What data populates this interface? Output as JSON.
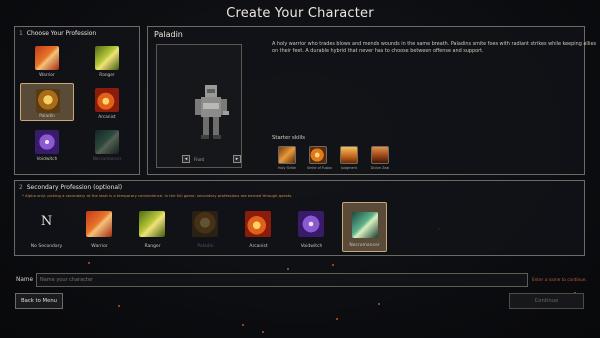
{
  "app": {
    "title": "Create Your Character"
  },
  "primary": {
    "number": "1",
    "heading": "Choose Your Profession",
    "professions": [
      {
        "label": "Warrior",
        "icon": "warrior-icon"
      },
      {
        "label": "Ranger",
        "icon": "ranger-icon"
      },
      {
        "label": "Paladin",
        "icon": "paladin-shield-icon",
        "selected": true
      },
      {
        "label": "Arcanist",
        "icon": "arcanist-fire-icon"
      },
      {
        "label": "Voidwitch",
        "icon": "voidwitch-lightning-icon"
      },
      {
        "label": "Necromancer",
        "icon": "necromancer-icon",
        "disabled": true
      }
    ]
  },
  "detail": {
    "name": "Paladin",
    "portrait_label": "Front",
    "prev_arrow": "◂",
    "next_arrow": "▸",
    "description": "A holy warrior who trades blows and mends wounds in the same breath. Paladins smite foes with radiant strikes while keeping allies on their feet. A durable hybrid that never has to choose between offense and support.",
    "starter_label": "Starter skills",
    "skills": [
      {
        "label": "Holy Strike",
        "icon": "holy-strike-icon"
      },
      {
        "label": "Smite of Fusion",
        "icon": "smite-icon"
      },
      {
        "label": "Judgment",
        "icon": "judgment-icon"
      },
      {
        "label": "Divine Zeal",
        "icon": "divine-zeal-icon"
      }
    ]
  },
  "secondary": {
    "number": "2",
    "heading": "Secondary Profession",
    "optional": "(optional)",
    "note": "* Alpha only: picking a secondary at the start is a temporary convenience. In the full game, secondary professions are earned through quests.",
    "options": [
      {
        "label": "No Secondary",
        "letter": "N"
      },
      {
        "label": "Warrior",
        "icon": "warrior-icon"
      },
      {
        "label": "Ranger",
        "icon": "ranger-icon"
      },
      {
        "label": "Paladin",
        "icon": "paladin-shield-icon",
        "disabled": true
      },
      {
        "label": "Arcanist",
        "icon": "arcanist-fire-icon"
      },
      {
        "label": "Voidwitch",
        "icon": "voidwitch-lightning-icon"
      },
      {
        "label": "Necromancer",
        "icon": "necromancer-icon",
        "selected": true
      }
    ]
  },
  "name_field": {
    "label": "Name",
    "value": "",
    "placeholder": "Name your character",
    "hint": "Enter a name to continue."
  },
  "buttons": {
    "back": "Back to Menu",
    "continue": "Continue"
  },
  "colors": {
    "accent_gold": "#c9a877",
    "selected_bg": "#5a4a38",
    "hint_red": "#c25b3c",
    "note_orange": "#cf8f47"
  }
}
